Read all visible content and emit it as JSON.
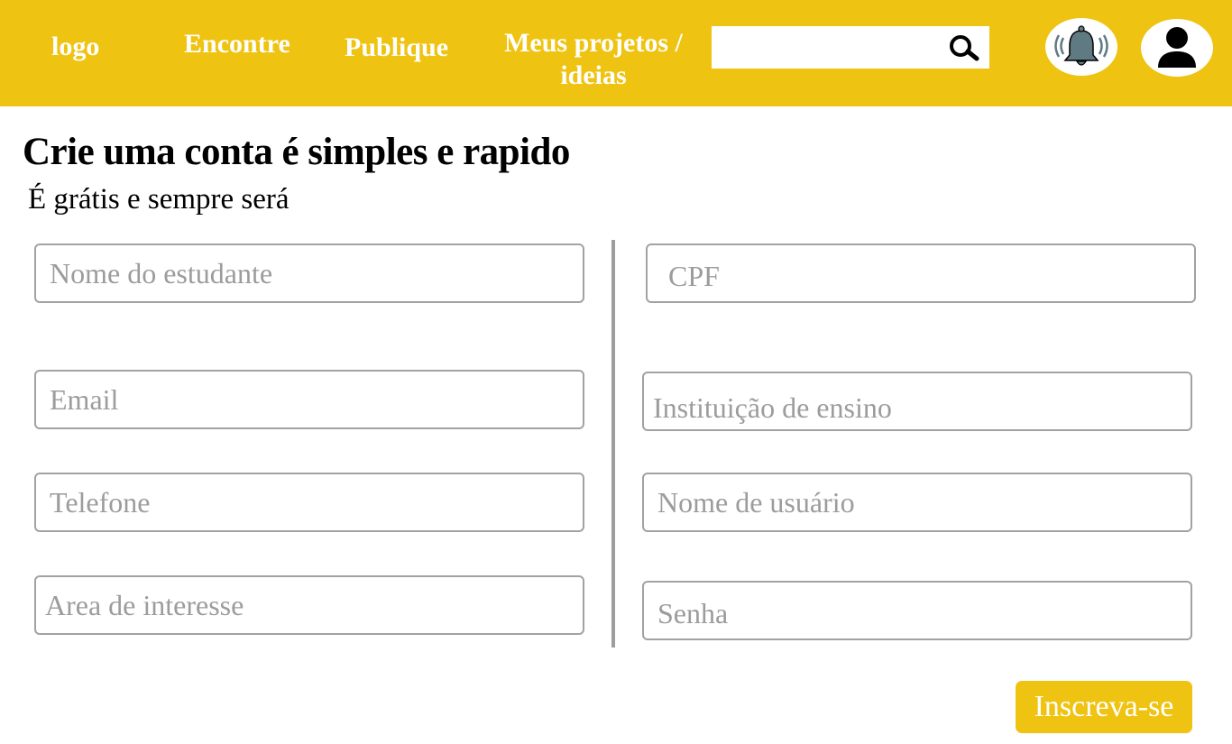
{
  "header": {
    "logo": "logo",
    "nav": {
      "find": "Encontre",
      "publish": "Publique",
      "projects": "Meus projetos / ideias"
    },
    "search": {
      "placeholder": "",
      "icon": "search-icon"
    },
    "notifications_icon": "bell-icon",
    "profile_icon": "user-icon",
    "colors": {
      "bar": "#efc311",
      "text": "#ffffff",
      "bell": "#5f7a83"
    }
  },
  "form": {
    "title": "Crie uma conta é simples e rapido",
    "subtitle": "É grátis e sempre será",
    "fields": {
      "student_name": {
        "placeholder": "Nome do estudante"
      },
      "email": {
        "placeholder": "Email"
      },
      "phone": {
        "placeholder": "Telefone"
      },
      "interest": {
        "placeholder": "Area de interesse"
      },
      "cpf": {
        "placeholder": "CPF"
      },
      "institution": {
        "placeholder": "Instituição de ensino"
      },
      "username": {
        "placeholder": "Nome de usuário"
      },
      "password": {
        "placeholder": "Senha"
      }
    },
    "submit_label": "Inscreva-se"
  }
}
